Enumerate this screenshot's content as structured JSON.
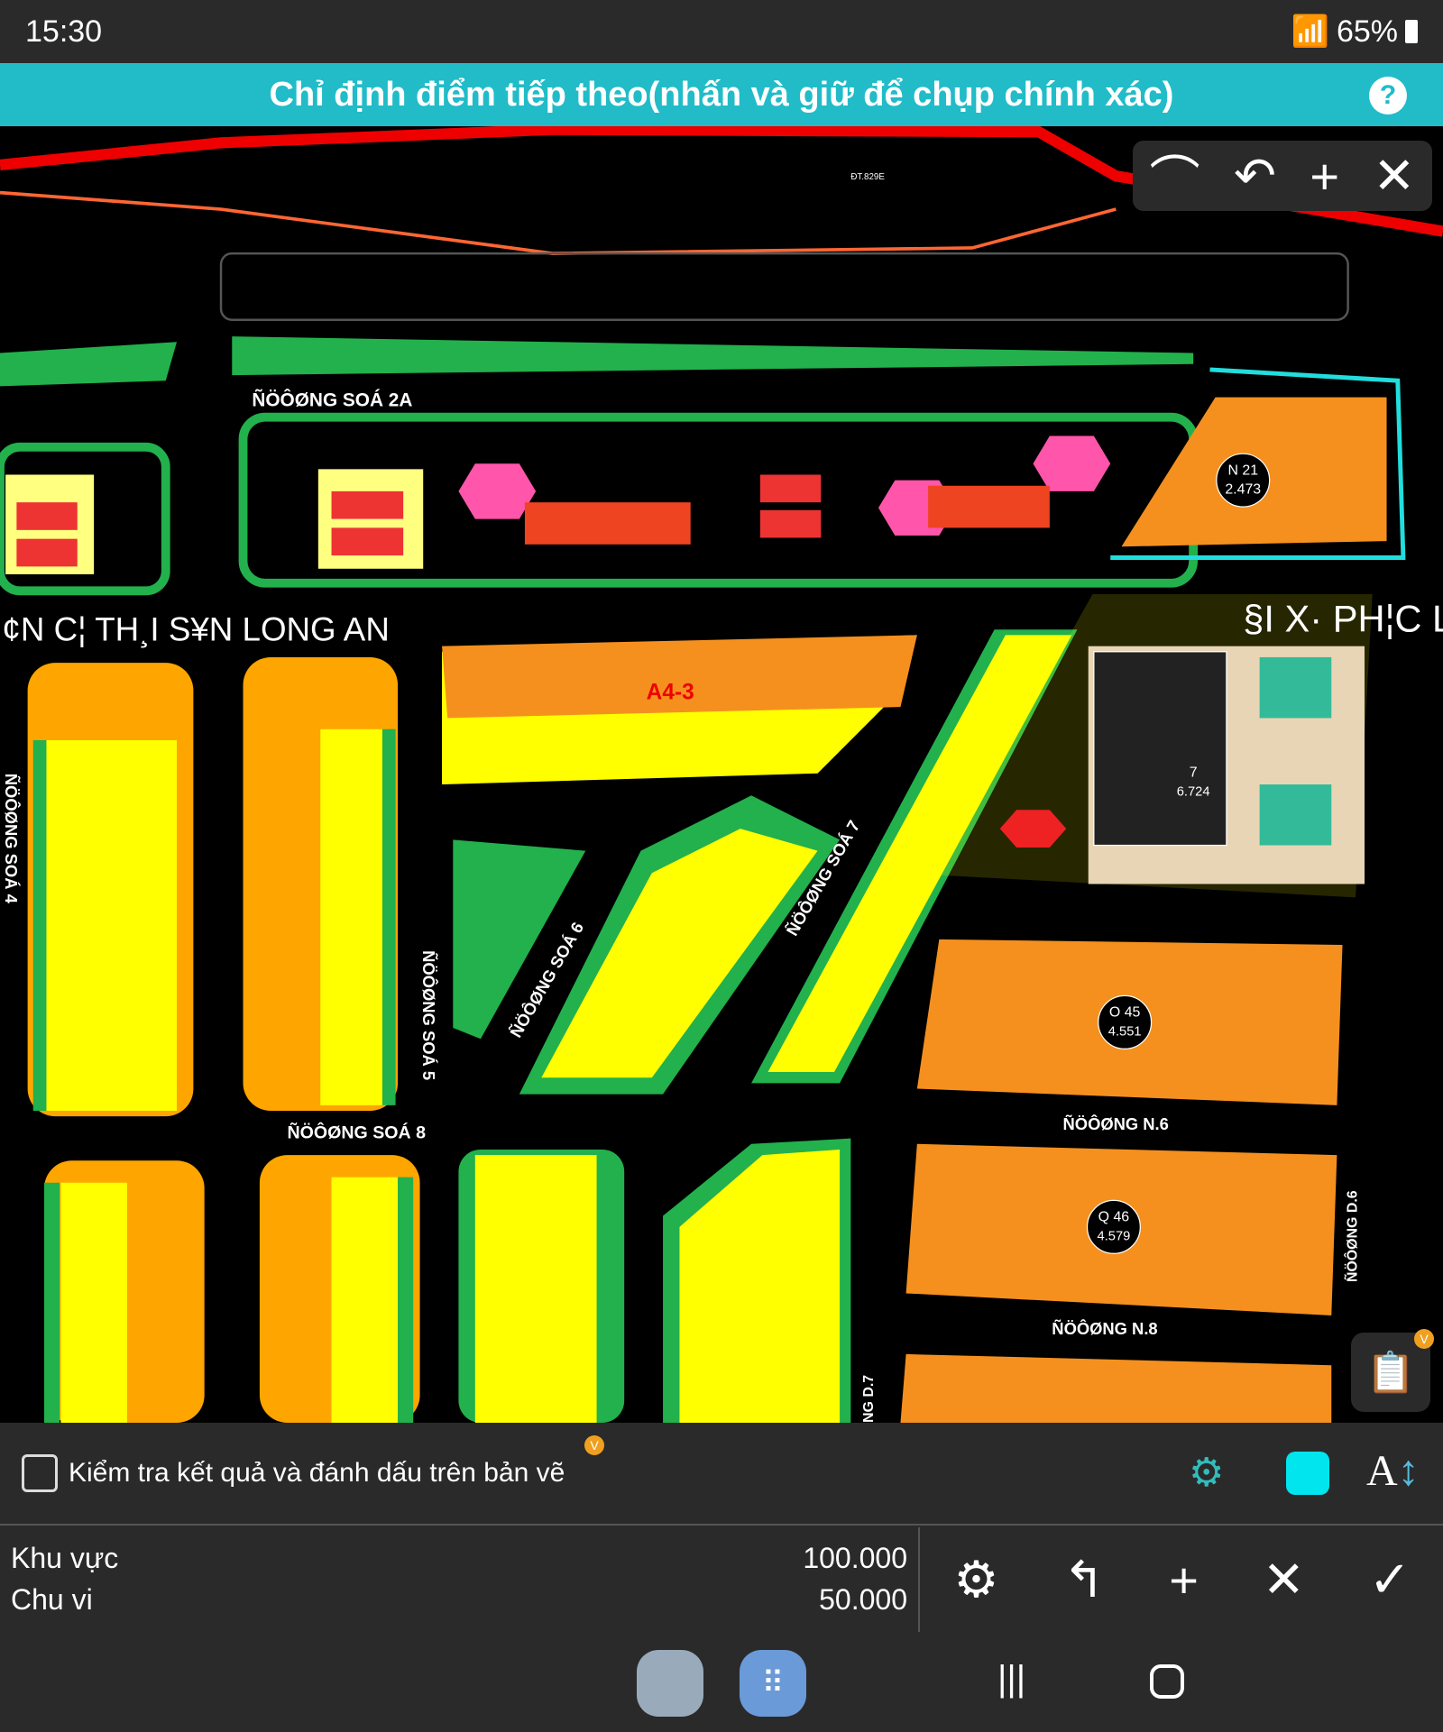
{
  "status": {
    "time": "15:30",
    "battery": "65%"
  },
  "header": {
    "title": "Chỉ định điểm tiếp theo(nhấn và giữ để chụp chính xác)",
    "help_icon": "question-icon"
  },
  "map_tools": [
    {
      "icon": "arc-icon",
      "glyph": "⌒"
    },
    {
      "icon": "undo-icon",
      "glyph": "↶"
    },
    {
      "icon": "plus-icon",
      "glyph": "+"
    },
    {
      "icon": "close-icon",
      "glyph": "✕"
    }
  ],
  "map_labels": {
    "road_top": "ĐT.829E",
    "road_2a": "ÑÖÔØNG SOÁ 2A",
    "area_title": "¢N C¦ TH¸I S¥N LONG AN",
    "road_4": "ÑÖÔØNG SOÁ 4",
    "road_5": "ÑÖÔØNG SOÁ 5",
    "road_6": "ÑÖÔØNG SOÁ 6",
    "road_7": "ÑÖÔØNG SOÁ 7",
    "road_8": "ÑÖÔØNG SOÁ 8",
    "road_n6": "ÑÖÔØNG N.6",
    "road_n8": "ÑÖÔØNG N.8",
    "road_d6": "ÑÖÔØNG D.6",
    "road_d7": "NG D.7",
    "school": "§I X· PH¦C L",
    "block_a": "A4-3",
    "n21": "N 21",
    "n21_area": "2.473",
    "o45": "O 45",
    "o45_area": "4.551",
    "q46": "Q 46",
    "q46_area": "4.579",
    "field": "7",
    "field_area": "6.724"
  },
  "colors": {
    "accent": "#21bcc8",
    "map_bg": "#000000",
    "lot_orange": "#f5901e",
    "yellow": "#ffff00",
    "green": "#22b14c"
  },
  "bottom": {
    "check_label": "Kiểm tra kết quả và đánh dấu trên bản vẽ",
    "check_checked": false,
    "badge": "V",
    "area_label": "Khu vực",
    "area_value": "100.000",
    "perimeter_label": "Chu vi",
    "perimeter_value": "50.000"
  },
  "actions": [
    {
      "icon": "settings-icon",
      "glyph": "⚙"
    },
    {
      "icon": "back-icon",
      "glyph": "↰"
    },
    {
      "icon": "plus-icon",
      "glyph": "+"
    },
    {
      "icon": "close-icon",
      "glyph": "✕"
    },
    {
      "icon": "check-icon",
      "glyph": "✓"
    }
  ]
}
